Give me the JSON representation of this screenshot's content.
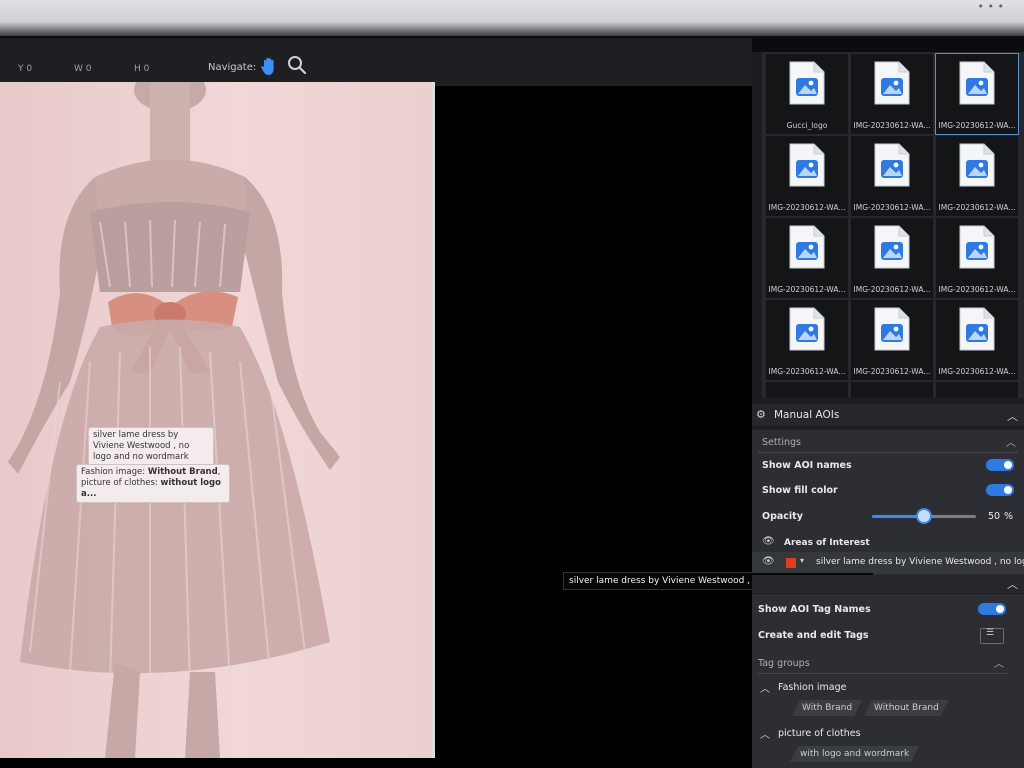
{
  "toolbar": {
    "y_label": "Y 0",
    "w_label": "W 0",
    "h_label": "H 0",
    "navigate_label": "Navigate:"
  },
  "aoi_labels": {
    "label1": "silver lame dress by Viviene Westwood , no logo and no wordmark",
    "label2_prefix1": "Fashion image: ",
    "label2_bold1": "Without Brand",
    "label2_sep": ",",
    "label2_prefix2": "picture of clothes: ",
    "label2_bold2": "without logo a..."
  },
  "thumbnails": [
    {
      "caption": "Gucci_logo"
    },
    {
      "caption": "IMG-20230612-WA..."
    },
    {
      "caption": "IMG-20230612-WA..."
    },
    {
      "caption": "IMG-20230612-WA..."
    },
    {
      "caption": "IMG-20230612-WA..."
    },
    {
      "caption": "IMG-20230612-WA..."
    },
    {
      "caption": "IMG-20230612-WA..."
    },
    {
      "caption": "IMG-20230612-WA..."
    },
    {
      "caption": "IMG-20230612-WA..."
    },
    {
      "caption": "IMG-20230612-WA..."
    },
    {
      "caption": "IMG-20230612-WA..."
    },
    {
      "caption": "IMG-20230612-WA..."
    }
  ],
  "manual_aois": {
    "title": "Manual AOIs",
    "settings_title": "Settings",
    "show_aoi_names": "Show AOI names",
    "show_fill_color": "Show fill color",
    "opacity_label": "Opacity",
    "opacity_value": "50",
    "opacity_unit": "%",
    "opacity_fraction": 0.5,
    "areas_title": "Areas of Interest",
    "aoi_item_name": "silver lame dress by Viviene Westwood , no logo",
    "aoi_color": "#e23b1f"
  },
  "tooltip": "silver lame dress by Viviene Westwood , no logo and no wordmark",
  "tags": {
    "show_tag_names": "Show AOI Tag Names",
    "create_edit_tags": "Create and edit Tags",
    "tag_groups_title": "Tag groups",
    "group1_name": "Fashion image",
    "group1_tags": [
      "With Brand",
      "Without Brand"
    ],
    "group2_name": "picture of clothes",
    "group2_tags": [
      "with logo and wordmark"
    ]
  },
  "colors": {
    "accent": "#2f7ae0"
  }
}
